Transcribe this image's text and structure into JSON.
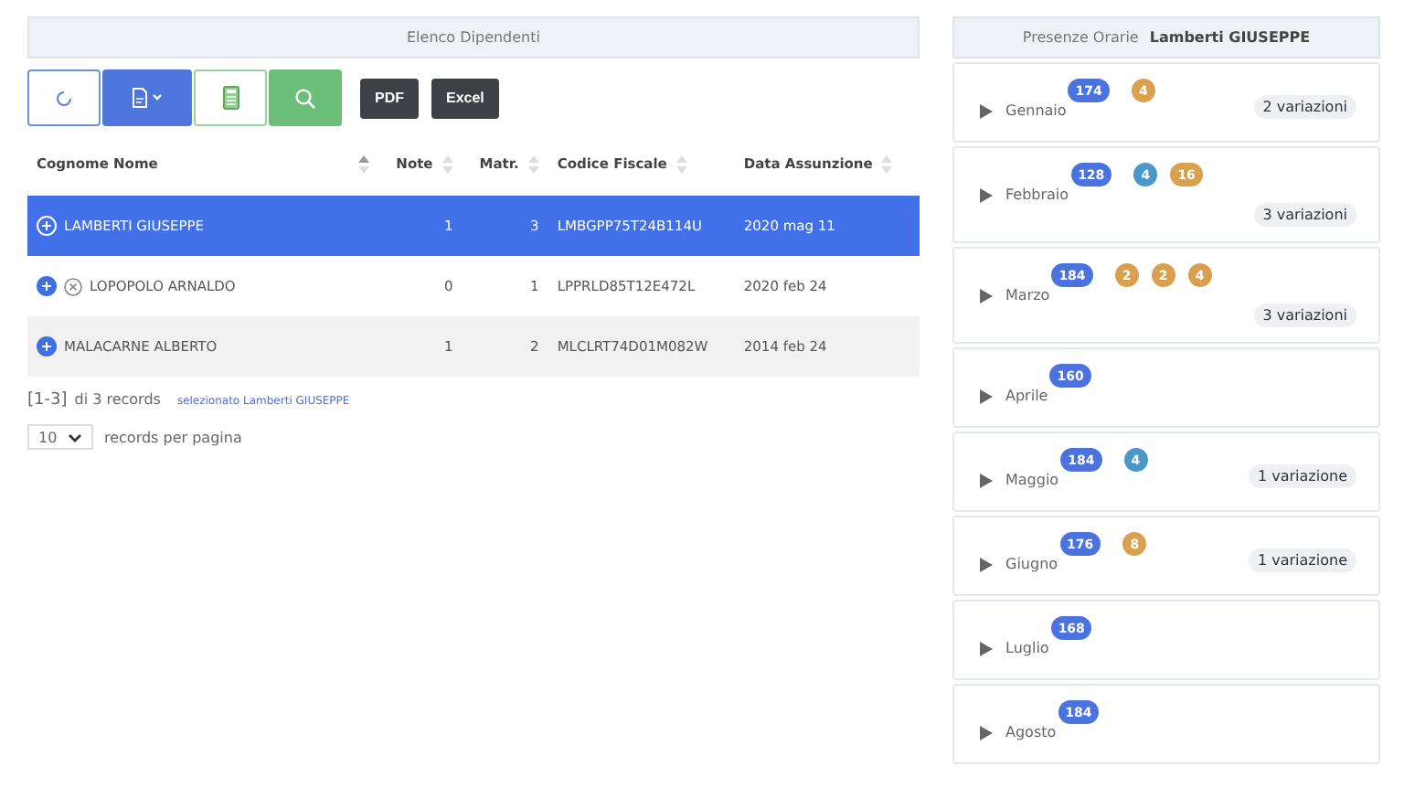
{
  "employees": {
    "title": "Elenco Dipendenti",
    "toolbar": [
      {
        "kind": "refresh"
      },
      {
        "kind": "export"
      },
      {
        "kind": "calculator"
      },
      {
        "kind": "search"
      },
      {
        "kind": "text",
        "label": "PDF"
      },
      {
        "kind": "text",
        "label": "Excel"
      }
    ],
    "columns": [
      {
        "label": "Cognome Nome",
        "sorted": true
      },
      {
        "label": "Note",
        "sorted": false
      },
      {
        "label": "Matr.",
        "sorted": false
      },
      {
        "label": "Codice Fiscale",
        "sorted": false
      },
      {
        "label": "Data Assunzione",
        "sorted": false
      }
    ],
    "rows": [
      {
        "name": "LAMBERTI GIUSEPPE",
        "note": "1",
        "matr": "3",
        "cf": "LMBGPP75T24B114U",
        "date": "2020 mag 11",
        "selected": true,
        "cancelled": false
      },
      {
        "name": "LOPOPOLO ARNALDO",
        "note": "0",
        "matr": "1",
        "cf": "LPPRLD85T12E472L",
        "date": "2020 feb 24",
        "selected": false,
        "cancelled": true
      },
      {
        "name": "MALACARNE ALBERTO",
        "note": "1",
        "matr": "2",
        "cf": "MLCLRT74D01M082W",
        "date": "2014 feb 24",
        "selected": false,
        "cancelled": false
      }
    ],
    "range": "[1-3]",
    "range_suffix": "di 3 records",
    "selection_note": "selezionato Lamberti GIUSEPPE",
    "page_size": "10",
    "page_size_label": "records per pagina"
  },
  "attendance": {
    "title": "Presenze Orarie",
    "employee": "Lamberti GIUSEPPE",
    "months": [
      {
        "name": "Gennaio",
        "badges": [
          {
            "text": "174",
            "color": "#4a73e0"
          },
          {
            "text": "4",
            "color": "#d9a04f"
          }
        ],
        "variations": "2 variazioni"
      },
      {
        "name": "Febbraio",
        "badges": [
          {
            "text": "128",
            "color": "#4a73e0"
          },
          {
            "text": "4",
            "color": "#4a98c9"
          },
          {
            "text": "16",
            "color": "#d9a04f"
          }
        ],
        "variations": "3 variazioni"
      },
      {
        "name": "Marzo",
        "badges": [
          {
            "text": "184",
            "color": "#4a73e0"
          },
          {
            "text": "2",
            "color": "#d9a04f"
          },
          {
            "text": "2",
            "color": "#d9a04f"
          },
          {
            "text": "4",
            "color": "#d9a04f"
          }
        ],
        "variations": "3 variazioni"
      },
      {
        "name": "Aprile",
        "badges": [
          {
            "text": "160",
            "color": "#4a73e0"
          }
        ]
      },
      {
        "name": "Maggio",
        "badges": [
          {
            "text": "184",
            "color": "#4a73e0"
          },
          {
            "text": "4",
            "color": "#4a98c9"
          }
        ],
        "variations": "1 variazione"
      },
      {
        "name": "Giugno",
        "badges": [
          {
            "text": "176",
            "color": "#4a73e0"
          },
          {
            "text": "8",
            "color": "#d9a04f"
          }
        ],
        "variations": "1 variazione"
      },
      {
        "name": "Luglio",
        "badges": [
          {
            "text": "168",
            "color": "#4a73e0"
          }
        ]
      },
      {
        "name": "Agosto",
        "badges": [
          {
            "text": "184",
            "color": "#4a73e0"
          }
        ]
      }
    ]
  }
}
